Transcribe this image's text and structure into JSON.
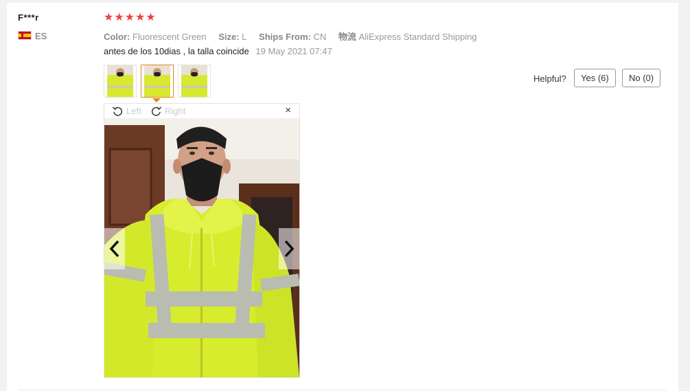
{
  "review": {
    "user_name": "F***r",
    "country_code": "ES",
    "rating_stars": 5,
    "color_label": "Color:",
    "color_value": "Fluorescent Green",
    "size_label": "Size:",
    "size_value": "L",
    "ships_label": "Ships From:",
    "ships_value": "CN",
    "logistics_label": "物流",
    "logistics_value": "AliExpress Standard Shipping",
    "text": "antes de los 10dias , la talla coincide",
    "date": "19 May 2021 07:47"
  },
  "helpful": {
    "label": "Helpful?",
    "yes_label": "Yes (6)",
    "no_label": "No (0)"
  },
  "viewer": {
    "rotate_left_label": "Left",
    "rotate_right_label": "Right",
    "close_label": "×",
    "active_thumb_index": 1,
    "thumb_count": 3
  },
  "colors": {
    "star": "#f0413e",
    "active_border": "#e9821a",
    "jacket": "#d8ec2e"
  }
}
